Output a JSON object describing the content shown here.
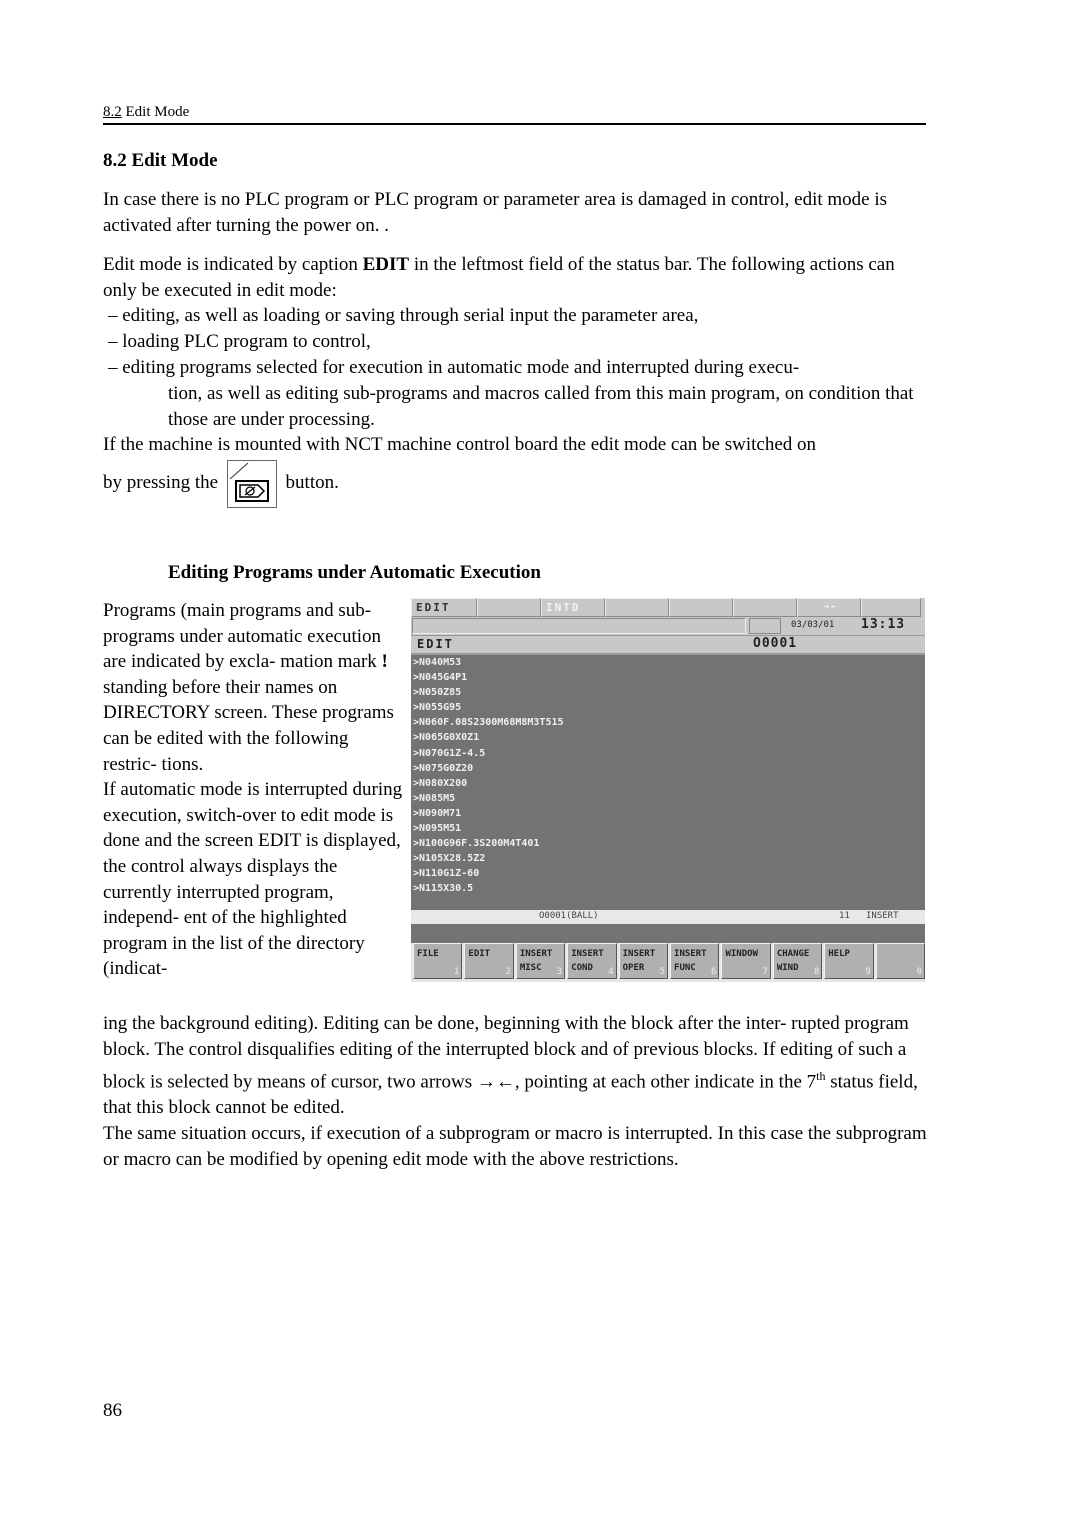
{
  "running_header": {
    "number": "8.2",
    "title": "Edit Mode"
  },
  "section_heading": "8.2 Edit Mode",
  "paragraphs": {
    "p1": "In case there is no PLC program or PLC program or parameter area is damaged in control, edit mode is activated after turning the power on. .",
    "p2_before": "Edit mode is indicated by caption ",
    "p2_bold": "EDIT",
    "p2_after": " in the leftmost field of the status bar. The following actions can only be executed in edit mode:",
    "items": [
      "– editing, as well as loading or saving through serial input the parameter area,",
      "– loading PLC program to control,",
      "– editing programs selected for execution in automatic mode and interrupted during execu-"
    ],
    "item3_cont": "tion, as well as editing sub-programs and macros called from this main program, on condition that those are under processing.",
    "p3": "If the machine is mounted with NCT machine control board the edit mode can be switched on",
    "p4_before": "by pressing the",
    "p4_after": "button."
  },
  "subheading": "Editing Programs under Automatic Execution",
  "side_text": {
    "a1": "Programs (main programs and sub-programs under automatic execution are indicated by excla- mation mark ",
    "a_bold": "!",
    "a2": " standing before their names on DIRECTORY screen. These programs can be edited with the following restric- tions.",
    "b": "If automatic mode is interrupted during execution, switch-over to edit mode is done and the screen EDIT is displayed, the control always displays the currently interrupted program, independ- ent of the highlighted program in the list of the directory (indicat-"
  },
  "full_text": {
    "c1": "ing the background editing). Editing can be done, beginning with the block after the inter- rupted program block. The control disqualifies editing of the interrupted block and of previous blocks. If editing of such a block is selected by means of cursor, two arrows →←, pointing at each other indicate in the 7",
    "c_sup": "th",
    "c2": " status field, that this block cannot be edited.",
    "d": "The same situation occurs, if execution of a subprogram or macro is interrupted. In this case the subprogram or macro can be modified by opening edit mode with the above restrictions."
  },
  "page_number": "86",
  "cnc_screen": {
    "status_fields": [
      "EDIT",
      "",
      "INTD",
      "",
      "",
      "",
      "→←",
      ""
    ],
    "date": "03/03/01",
    "time": "13:13",
    "title_left": "EDIT",
    "title_right": "O0001",
    "program_lines": [
      ">N040M53",
      ">N045G4P1",
      ">N050Z85",
      ">N055G95",
      ">N060F.08S2300M68M8M3T515",
      ">N065G0X0Z1",
      ">N070G1Z-4.5",
      ">N075G0Z20",
      ">N080X200",
      ">N085M5",
      ">N090M71",
      ">N095M51",
      ">N100G96F.3S200M4T401",
      ">N105X28.5Z2",
      ">N110G1Z-60",
      ">N115X30.5"
    ],
    "program_name": "O0001(BALL)",
    "line_count": "11",
    "insert_mode": "INSERT",
    "softkeys": [
      {
        "label": "FILE",
        "num": "1"
      },
      {
        "label": "EDIT",
        "num": "2"
      },
      {
        "label": "INSERT\nMISC",
        "num": "3"
      },
      {
        "label": "INSERT\nCOND",
        "num": "4"
      },
      {
        "label": "INSERT\nOPER",
        "num": "5"
      },
      {
        "label": "INSERT\nFUNC",
        "num": "6"
      },
      {
        "label": "WINDOW",
        "num": "7"
      },
      {
        "label": "CHANGE\nWIND",
        "num": "8"
      },
      {
        "label": "HELP",
        "num": "9"
      },
      {
        "label": "",
        "num": "0"
      }
    ]
  }
}
